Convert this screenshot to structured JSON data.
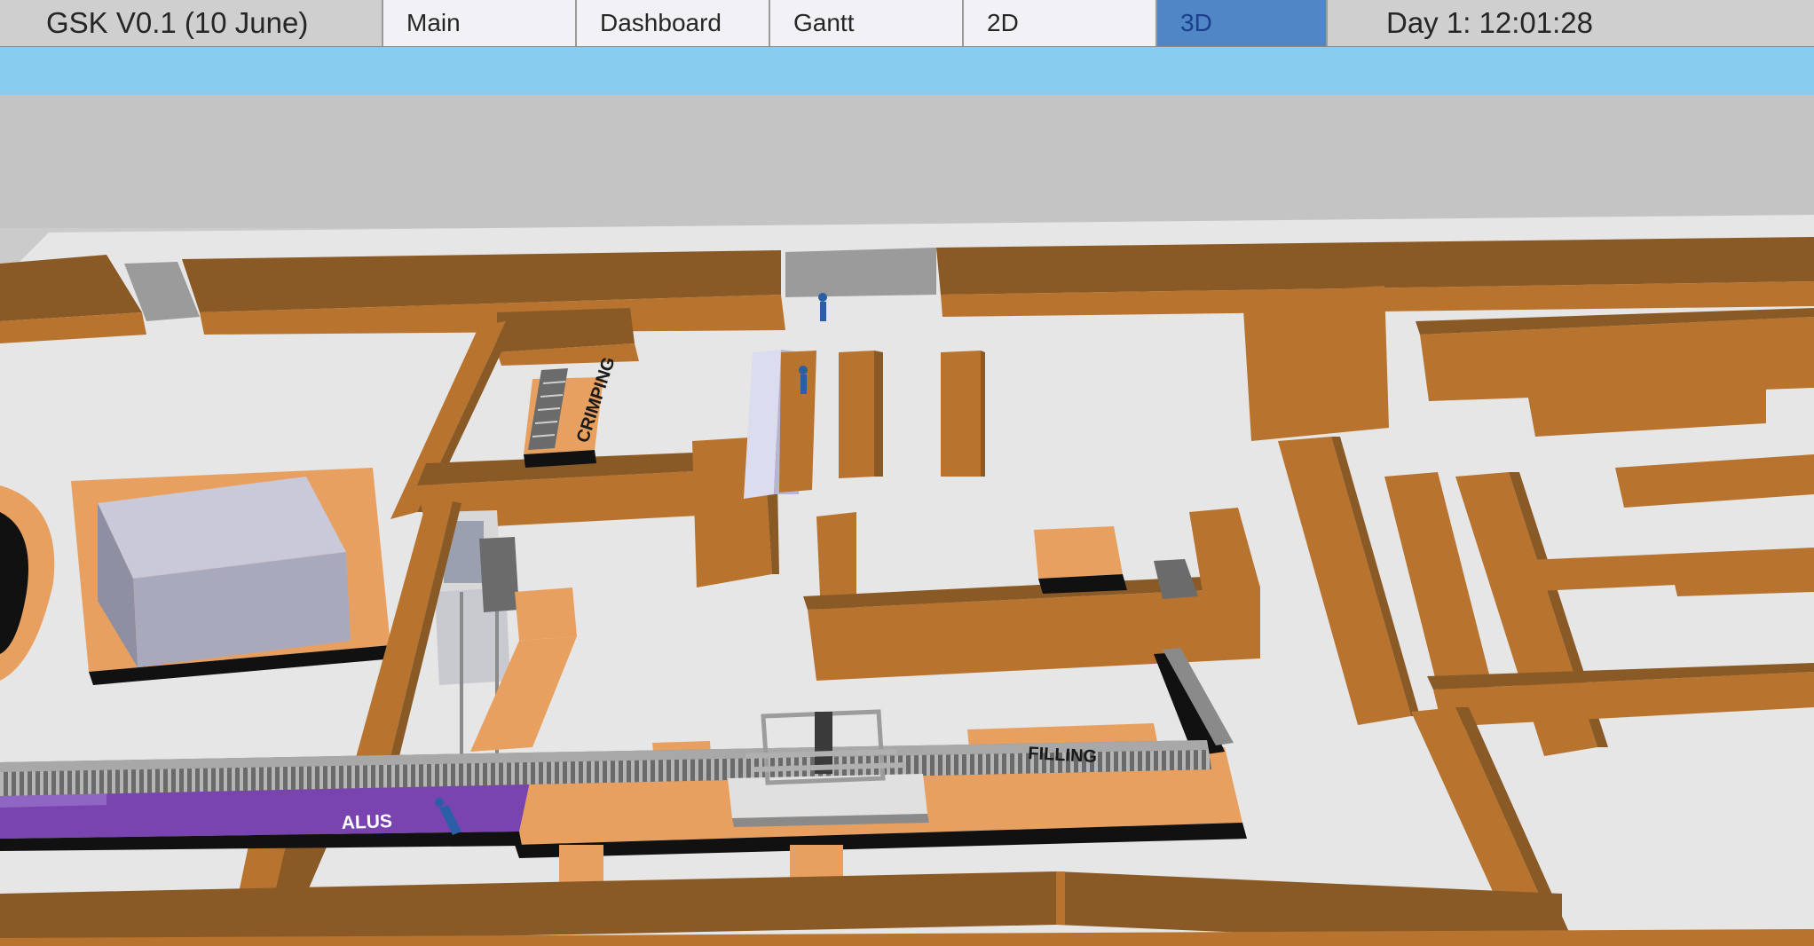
{
  "app": {
    "title": "GSK V0.1 (10 June)"
  },
  "tabs": [
    {
      "label": "Main",
      "active": false
    },
    {
      "label": "Dashboard",
      "active": false
    },
    {
      "label": "Gantt",
      "active": false
    },
    {
      "label": "2D",
      "active": false
    },
    {
      "label": "3D",
      "active": true
    }
  ],
  "clock": "Day 1: 12:01:28",
  "scene": {
    "labels": {
      "crimping": "CRIMPING",
      "filling": "FILLING",
      "alus": "ALUS"
    }
  },
  "colors": {
    "wall_top": "#8a5a26",
    "wall_side": "#b8742e",
    "floor_zone": "#e8a060",
    "floor": "#e6e6e6",
    "alus_zone": "#7a44b0",
    "header_blue": "#88cdf0",
    "active_tab": "#4f86c6"
  }
}
